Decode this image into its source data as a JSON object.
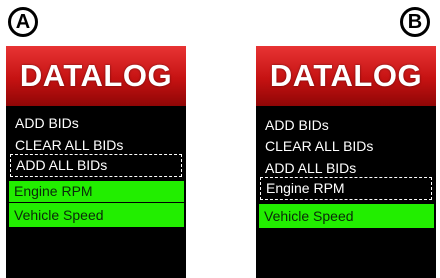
{
  "labels": {
    "a": "A",
    "b": "B"
  },
  "screen_a": {
    "title": "DATALOG",
    "items": [
      "ADD BIDs",
      "CLEAR ALL BIDs",
      "ADD ALL BIDs",
      "Engine RPM",
      "Vehicle Speed"
    ],
    "cursor_item": "ADD ALL BIDs",
    "selected_items": [
      "Engine RPM",
      "Vehicle Speed"
    ]
  },
  "screen_b": {
    "title": "DATALOG",
    "items": [
      "ADD BIDs",
      "CLEAR ALL BIDs",
      "ADD ALL BIDs",
      "Engine RPM",
      "Vehicle Speed"
    ],
    "cursor_item": "Engine RPM",
    "selected_items": [
      "Vehicle Speed"
    ]
  },
  "colors": {
    "header_red": "#c51212",
    "selected_green": "#22ee00",
    "screen_background": "#000000"
  }
}
